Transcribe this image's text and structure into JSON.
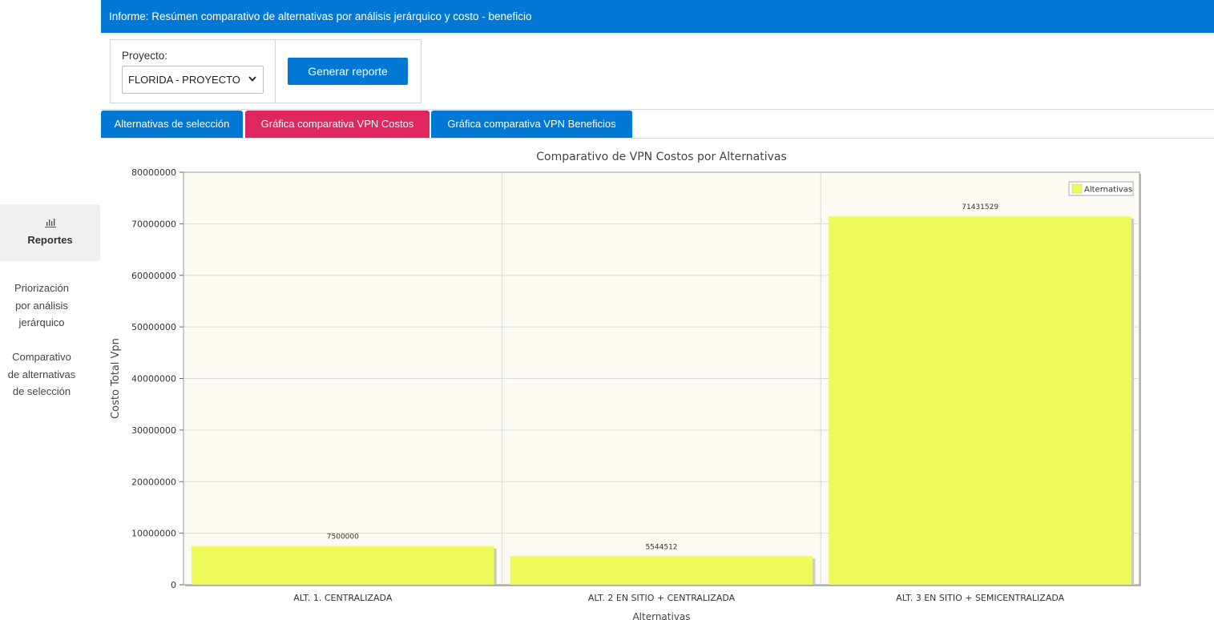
{
  "sidebar": {
    "active": {
      "label": "Reportes",
      "icon": "bar-chart-icon"
    },
    "links": [
      {
        "label": [
          "Priorización",
          "por análisis",
          "jerárquico"
        ]
      },
      {
        "label": [
          "Comparativo",
          "de alternativas",
          "de selección"
        ]
      }
    ]
  },
  "header": {
    "title": "Informe: Resúmen comparativo de alternativas por análisis jerárquico y costo - beneficio"
  },
  "controls": {
    "project_label": "Proyecto:",
    "project_value": "FLORIDA - PROYECTO",
    "generate_label": "Generar reporte"
  },
  "tabs": [
    {
      "label": "Alternativas de selección",
      "color": "#0078d4"
    },
    {
      "label": "Gráfica comparativa VPN Costos",
      "color": "#e0265f"
    },
    {
      "label": "Gráfica comparativa VPN Beneficios",
      "color": "#0078d4"
    }
  ],
  "chart_data": {
    "type": "bar",
    "title": "Comparativo de VPN Costos por Alternativas",
    "xlabel": "Alternativas",
    "ylabel": "Costo Total Vpn",
    "categories": [
      "ALT. 1. CENTRALIZADA",
      "ALT. 2 EN SITIO + CENTRALIZADA",
      "ALT. 3 EN SITIO + SEMICENTRALIZADA"
    ],
    "series": [
      {
        "name": "Alternativas",
        "values": [
          7500000,
          5544512,
          71431529
        ],
        "color": "#eef95a"
      }
    ],
    "data_labels": [
      "7500000",
      "5544512",
      "71431529"
    ],
    "ylim": [
      0,
      80000000
    ],
    "yticks": [
      "0",
      "10000000",
      "20000000",
      "30000000",
      "40000000",
      "50000000",
      "60000000",
      "70000000",
      "80000000"
    ],
    "grid": true,
    "legend_position": "top-right",
    "plot_background": "#fdfaf3"
  }
}
